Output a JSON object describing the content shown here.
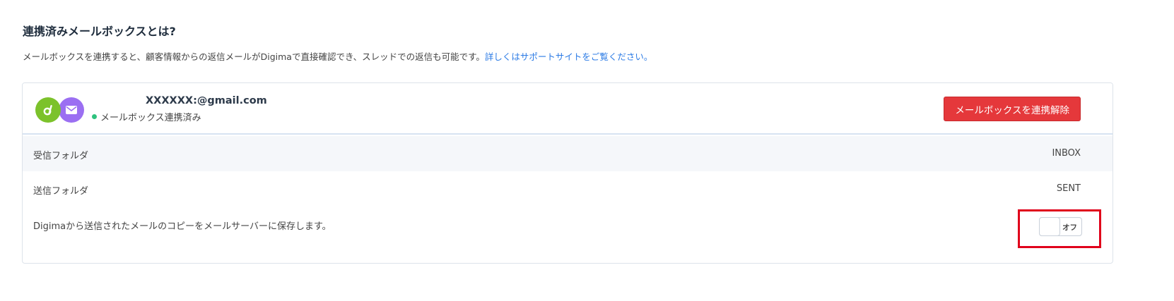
{
  "section": {
    "title": "連携済みメールボックスとは?",
    "description": "メールボックスを連携すると、顧客情報からの返信メールがDigimaで直接確認でき、スレッドでの返信も可能です。",
    "support_link": "詳しくはサポートサイトをご覧ください。"
  },
  "account": {
    "email": "XXXXXX:@gmail.com",
    "status": "メールボックス連携済み",
    "status_color": "#2ec27e",
    "avatar_icons": [
      "digima-logo-icon",
      "mail-icon"
    ],
    "disconnect_label": "メールボックスを連携解除"
  },
  "settings": {
    "inbox_label": "受信フォルダ",
    "inbox_value": "INBOX",
    "sent_label": "送信フォルダ",
    "sent_value": "SENT",
    "copy_label": "Digimaから送信されたメールのコピーをメールサーバーに保存します。",
    "copy_toggle_state": "オフ"
  },
  "colors": {
    "accent_red": "#e5383b",
    "link_blue": "#2c7be5",
    "highlight": "#e0001b"
  }
}
